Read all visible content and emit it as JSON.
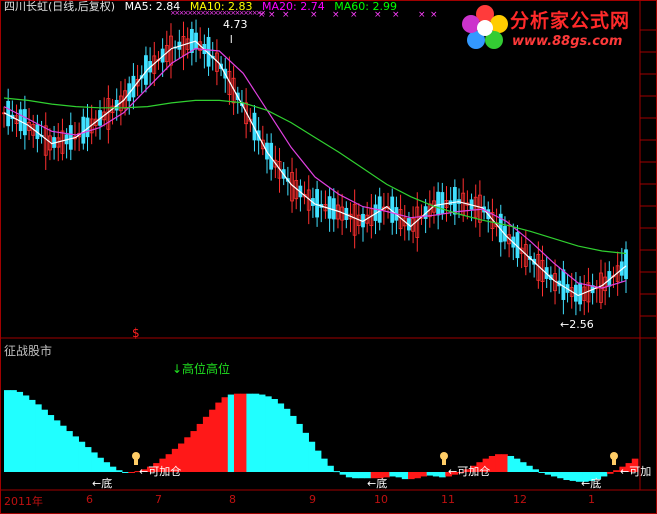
{
  "header": {
    "title": "四川长虹(日线,后复权)",
    "ma5": "MA5: 2.84",
    "ma10": "MA10: 2.83",
    "ma20": "MA20: 2.74",
    "ma60": "MA60: 2.99"
  },
  "colors": {
    "title": "#e0e0e0",
    "ma5": "#ffffff",
    "ma10": "#ffff00",
    "ma20": "#ff00ff",
    "ma60": "#00ff00",
    "candle_up": "#ff3030",
    "candle_down": "#40e0ff",
    "ma5_line": "#ffffff",
    "ma20_line": "#e040e0",
    "ma60_line": "#30d030",
    "hist_red": "#ff1818",
    "hist_cyan": "#20ffff",
    "frame": "#a00000"
  },
  "logo": {
    "text": "分析家公式网",
    "url": "www.88gs.com"
  },
  "annotations": {
    "high_price": "4.73",
    "low_price": "←2.56",
    "marker_s": "$",
    "indicator_name": "征战股市",
    "high_position": "↓高位高位",
    "bottom_left": "←底",
    "add_position_left": "←可加仓",
    "bottom_mid": "←底",
    "add_position_mid": "←可加仓",
    "bottom_right": "←底",
    "add_position_right": "←可加"
  },
  "chart_data": [
    {
      "type": "line",
      "title": "四川长虹(日线,后复权)",
      "x_tick_labels": [
        "2011年",
        "6",
        "7",
        "8",
        "9",
        "10",
        "11",
        "12",
        "1"
      ],
      "ylim": [
        2.3,
        4.9
      ],
      "series": [
        {
          "name": "MA5",
          "x": [
            0,
            10,
            20,
            30,
            40,
            50,
            60,
            70,
            80,
            90,
            100,
            110,
            120,
            130,
            140,
            150,
            160,
            170,
            180,
            190,
            200,
            210,
            220,
            230,
            240,
            250,
            260
          ],
          "values": [
            4.1,
            4.0,
            3.85,
            3.9,
            4.05,
            4.2,
            4.45,
            4.62,
            4.68,
            4.5,
            4.15,
            3.78,
            3.52,
            3.36,
            3.3,
            3.22,
            3.34,
            3.18,
            3.35,
            3.38,
            3.33,
            3.1,
            2.92,
            2.74,
            2.62,
            2.7,
            2.86
          ]
        },
        {
          "name": "MA20",
          "x": [
            0,
            10,
            20,
            30,
            40,
            50,
            60,
            70,
            80,
            90,
            100,
            110,
            120,
            130,
            140,
            150,
            160,
            170,
            180,
            190,
            200,
            210,
            220,
            230,
            240,
            250,
            260
          ],
          "values": [
            4.15,
            4.05,
            3.95,
            3.92,
            3.98,
            4.1,
            4.3,
            4.5,
            4.62,
            4.6,
            4.42,
            4.12,
            3.82,
            3.58,
            3.44,
            3.34,
            3.3,
            3.25,
            3.27,
            3.3,
            3.32,
            3.22,
            3.06,
            2.88,
            2.72,
            2.68,
            2.74
          ]
        },
        {
          "name": "MA60",
          "x": [
            0,
            10,
            20,
            30,
            40,
            50,
            60,
            70,
            80,
            90,
            100,
            110,
            120,
            130,
            140,
            150,
            160,
            170,
            180,
            190,
            200,
            210,
            220,
            230,
            240,
            250,
            260
          ],
          "values": [
            4.22,
            4.2,
            4.17,
            4.15,
            4.14,
            4.14,
            4.15,
            4.18,
            4.2,
            4.2,
            4.18,
            4.12,
            4.02,
            3.9,
            3.78,
            3.65,
            3.52,
            3.42,
            3.34,
            3.28,
            3.23,
            3.19,
            3.14,
            3.08,
            3.02,
            2.98,
            2.96
          ]
        }
      ],
      "annotations": [
        {
          "text": "4.73",
          "x": 95,
          "y": 4.73
        },
        {
          "text": "←2.56",
          "x": 232,
          "y": 2.56
        }
      ]
    },
    {
      "type": "bar",
      "title": "征战股市",
      "x_tick_labels": [
        "2011年",
        "6",
        "7",
        "8",
        "9",
        "10",
        "11",
        "12",
        "1"
      ],
      "ylim": [
        -1,
        10
      ],
      "values": [
        9.2,
        9.2,
        9.0,
        8.6,
        8.1,
        7.6,
        7.0,
        6.4,
        5.8,
        5.2,
        4.6,
        4.0,
        3.4,
        2.8,
        2.2,
        1.6,
        1.1,
        0.6,
        0.2,
        0.0,
        0.0,
        0.1,
        0.3,
        0.6,
        1.0,
        1.5,
        2.0,
        2.6,
        3.2,
        3.9,
        4.6,
        5.4,
        6.2,
        7.0,
        7.8,
        8.4,
        8.7,
        8.8,
        8.8,
        8.8,
        8.8,
        8.7,
        8.5,
        8.2,
        7.7,
        7.1,
        6.3,
        5.4,
        4.4,
        3.4,
        2.4,
        1.5,
        0.7,
        0.1,
        -0.3,
        -0.6,
        -0.7,
        -0.7,
        -0.7,
        -0.7,
        -0.7,
        -0.6,
        -0.5,
        -0.6,
        -0.8,
        -0.8,
        -0.7,
        -0.5,
        -0.4,
        -0.5,
        -0.6,
        -0.5,
        -0.3,
        -0.1,
        0.3,
        0.7,
        1.1,
        1.5,
        1.8,
        2.0,
        2.0,
        1.8,
        1.5,
        1.1,
        0.7,
        0.3,
        0.0,
        -0.3,
        -0.5,
        -0.7,
        -0.9,
        -1.0,
        -1.1,
        -1.1,
        -1.0,
        -0.8,
        -0.5,
        -0.2,
        0.2,
        0.6,
        1.0,
        1.5
      ],
      "colors": [
        "c",
        "c",
        "c",
        "c",
        "c",
        "c",
        "c",
        "c",
        "c",
        "c",
        "c",
        "c",
        "c",
        "c",
        "c",
        "c",
        "c",
        "c",
        "c",
        "c",
        "r",
        "r",
        "r",
        "r",
        "r",
        "r",
        "r",
        "r",
        "r",
        "r",
        "r",
        "r",
        "r",
        "r",
        "r",
        "r",
        "c",
        "r",
        "r",
        "c",
        "c",
        "c",
        "c",
        "c",
        "c",
        "c",
        "c",
        "c",
        "c",
        "c",
        "c",
        "c",
        "c",
        "c",
        "c",
        "c",
        "c",
        "c",
        "c",
        "r",
        "r",
        "r",
        "c",
        "c",
        "c",
        "r",
        "r",
        "r",
        "c",
        "c",
        "c",
        "r",
        "r",
        "r",
        "r",
        "r",
        "r",
        "r",
        "r",
        "r",
        "r",
        "c",
        "c",
        "c",
        "c",
        "c",
        "c",
        "c",
        "c",
        "c",
        "c",
        "c",
        "c",
        "c",
        "c",
        "c",
        "c",
        "r",
        "r",
        "r",
        "r",
        "r",
        "r",
        "r"
      ]
    }
  ]
}
